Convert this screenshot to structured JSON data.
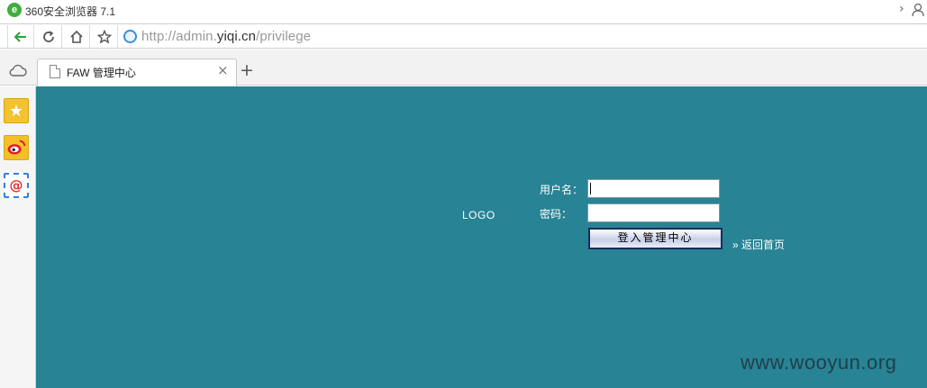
{
  "app": {
    "title": "360安全浏览器 7.1"
  },
  "nav": {
    "url_prefix": "http://admin.",
    "url_host": "yiqi.cn",
    "url_path": "/privilege"
  },
  "tab": {
    "title": "FAW 管理中心",
    "close": "×",
    "new": "+"
  },
  "sidebar": {
    "items": [
      {
        "icon": "star-icon"
      },
      {
        "icon": "weibo-icon"
      },
      {
        "icon": "mail-icon",
        "glyph": "@"
      }
    ]
  },
  "page": {
    "logo": "LOGO",
    "username_label": "用户名：",
    "password_label": "密码：",
    "username_value": "",
    "password_value": "",
    "login_button": "登入管理中心",
    "back_link": "» 返回首页",
    "watermark": "www.wooyun.org",
    "background": "#288394"
  }
}
